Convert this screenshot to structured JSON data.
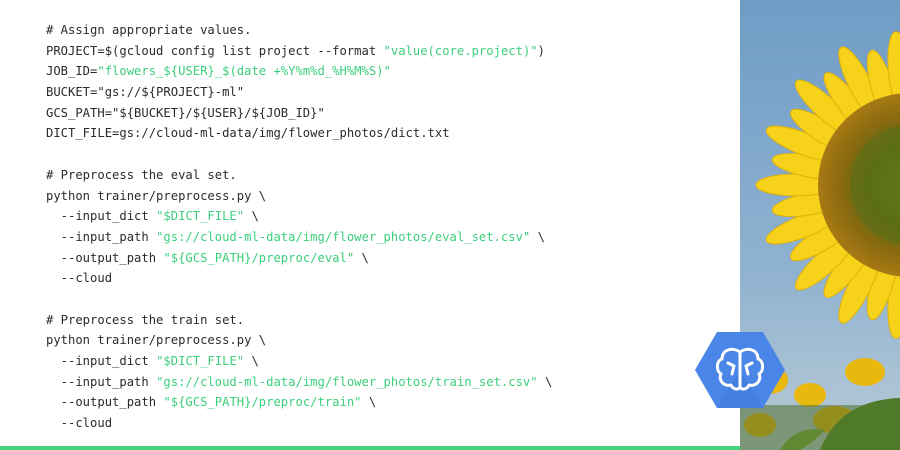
{
  "code": {
    "lines": [
      [
        {
          "t": "# Assign appropriate values."
        }
      ],
      [
        {
          "t": "PROJECT=$(gcloud config list project --format "
        },
        {
          "t": "\"value(core.project)\"",
          "s": 1
        },
        {
          "t": ")"
        }
      ],
      [
        {
          "t": "JOB_ID="
        },
        {
          "t": "\"flowers_${USER}_$(date +%Y%m%d_%H%M%S)\"",
          "s": 1
        }
      ],
      [
        {
          "t": "BUCKET=\"gs://${PROJECT}-ml\""
        }
      ],
      [
        {
          "t": "GCS_PATH=\"${BUCKET}/${USER}/${JOB_ID}\""
        }
      ],
      [
        {
          "t": "DICT_FILE=gs://cloud-ml-data/img/flower_photos/dict.txt"
        }
      ],
      [
        {
          "t": ""
        }
      ],
      [
        {
          "t": "# Preprocess the eval set."
        }
      ],
      [
        {
          "t": "python trainer/preprocess.py \\"
        }
      ],
      [
        {
          "t": "  --input_dict "
        },
        {
          "t": "\"$DICT_FILE\"",
          "s": 1
        },
        {
          "t": " \\"
        }
      ],
      [
        {
          "t": "  --input_path "
        },
        {
          "t": "\"gs://cloud-ml-data/img/flower_photos/eval_set.csv\"",
          "s": 1
        },
        {
          "t": " \\"
        }
      ],
      [
        {
          "t": "  --output_path "
        },
        {
          "t": "\"${GCS_PATH}/preproc/eval\"",
          "s": 1
        },
        {
          "t": " \\"
        }
      ],
      [
        {
          "t": "  --cloud"
        }
      ],
      [
        {
          "t": ""
        }
      ],
      [
        {
          "t": "# Preprocess the train set."
        }
      ],
      [
        {
          "t": "python trainer/preprocess.py \\"
        }
      ],
      [
        {
          "t": "  --input_dict "
        },
        {
          "t": "\"$DICT_FILE\"",
          "s": 1
        },
        {
          "t": " \\"
        }
      ],
      [
        {
          "t": "  --input_path "
        },
        {
          "t": "\"gs://cloud-ml-data/img/flower_photos/train_set.csv\"",
          "s": 1
        },
        {
          "t": " \\"
        }
      ],
      [
        {
          "t": "  --output_path "
        },
        {
          "t": "\"${GCS_PATH}/preproc/train\"",
          "s": 1
        },
        {
          "t": " \\"
        }
      ],
      [
        {
          "t": "  --cloud"
        }
      ]
    ]
  },
  "colors": {
    "text": "#2b2b2b",
    "string": "#3ccf7c",
    "accent_bar": "#43d67e",
    "badge_blue": "#4a86e8",
    "petal_yellow": "#f6d21a",
    "sky_blue": "#7fa6c9"
  },
  "icons": {
    "badge": "cloud-ml-brain-icon",
    "photo": "sunflower-photo"
  }
}
